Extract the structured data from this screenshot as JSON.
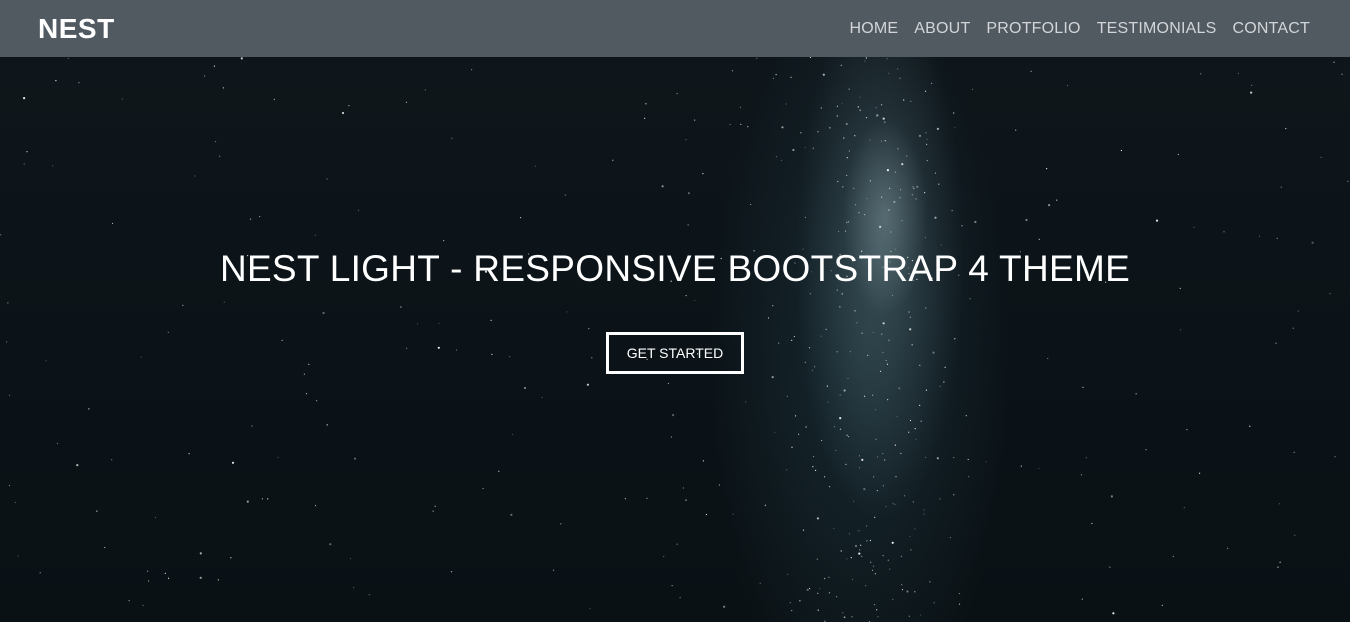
{
  "navbar": {
    "brand": "NEST",
    "links": [
      {
        "label": "HOME"
      },
      {
        "label": "ABOUT"
      },
      {
        "label": "PROTFOLIO"
      },
      {
        "label": "TESTIMONIALS"
      },
      {
        "label": "CONTACT"
      }
    ]
  },
  "hero": {
    "title": "NEST LIGHT - RESPONSIVE BOOTSTRAP 4 THEME",
    "cta_label": "GET STARTED"
  },
  "colors": {
    "navbar_bg": "#515961",
    "hero_bg": "#0c1419",
    "text": "#ffffff",
    "nav_link": "#d2d6d9"
  }
}
